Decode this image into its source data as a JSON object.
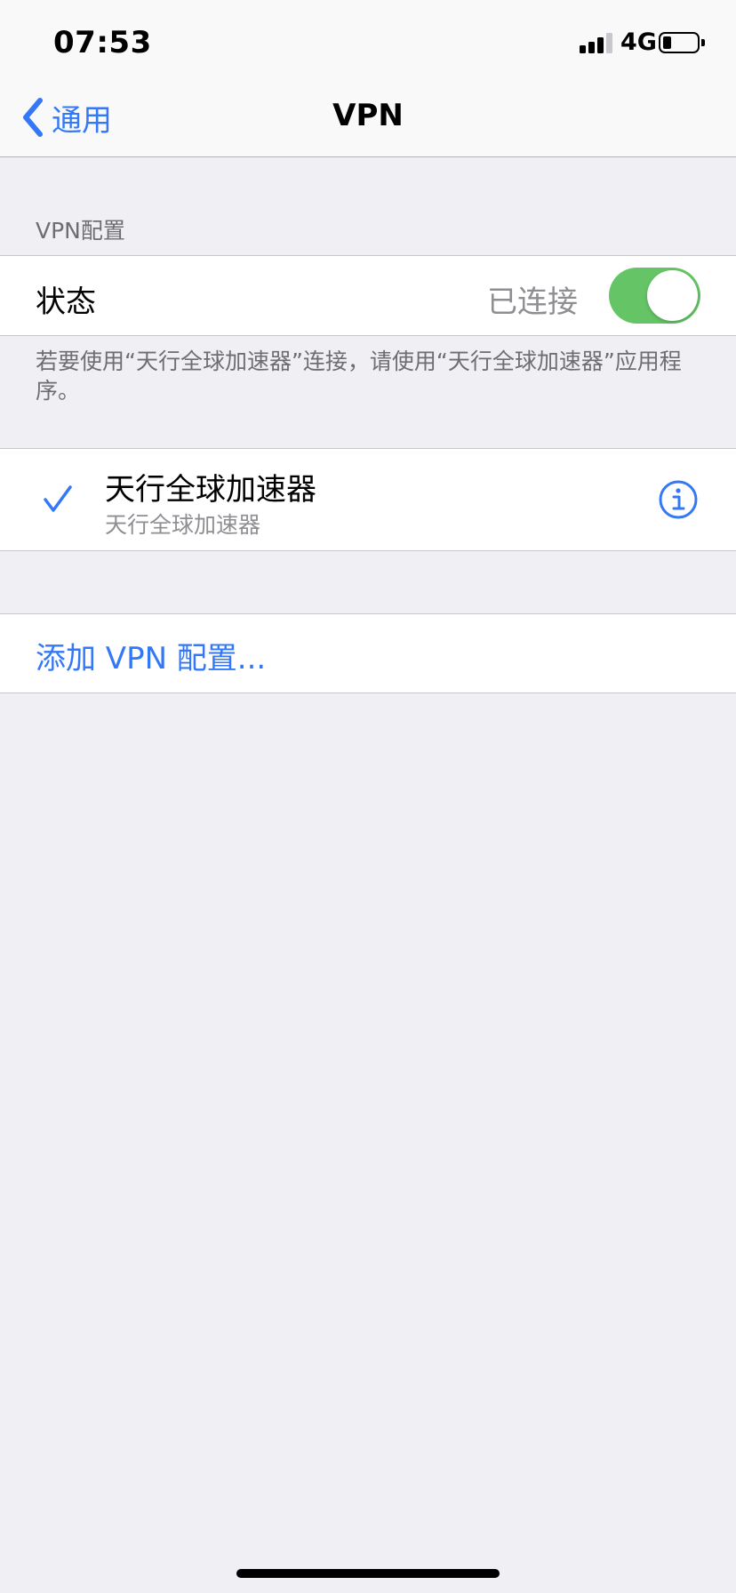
{
  "status_bar": {
    "time": "07:53",
    "network": "4G",
    "signal_bars_active": 3,
    "signal_bars_total": 4,
    "battery_level_fraction": 0.25
  },
  "nav": {
    "back_label": "通用",
    "title": "VPN"
  },
  "section": {
    "header": "VPN配置",
    "status_label": "状态",
    "status_value": "已连接",
    "toggle_on": true,
    "footer_note": "若要使用“天行全球加速器”连接，请使用“天行全球加速器”应用程序。"
  },
  "vpn_list": [
    {
      "name": "天行全球加速器",
      "subtitle": "天行全球加速器",
      "selected": true
    }
  ],
  "add_config_label": "添加 VPN 配置...",
  "colors": {
    "accent": "#3478f6",
    "toggle_on": "#65c466",
    "background": "#efeff4",
    "secondary_text": "#8e8e93"
  },
  "icons": {
    "back": "chevron-left-icon",
    "check": "checkmark-icon",
    "info": "info-circle-icon",
    "signal": "cellular-signal-icon",
    "battery": "battery-icon"
  }
}
